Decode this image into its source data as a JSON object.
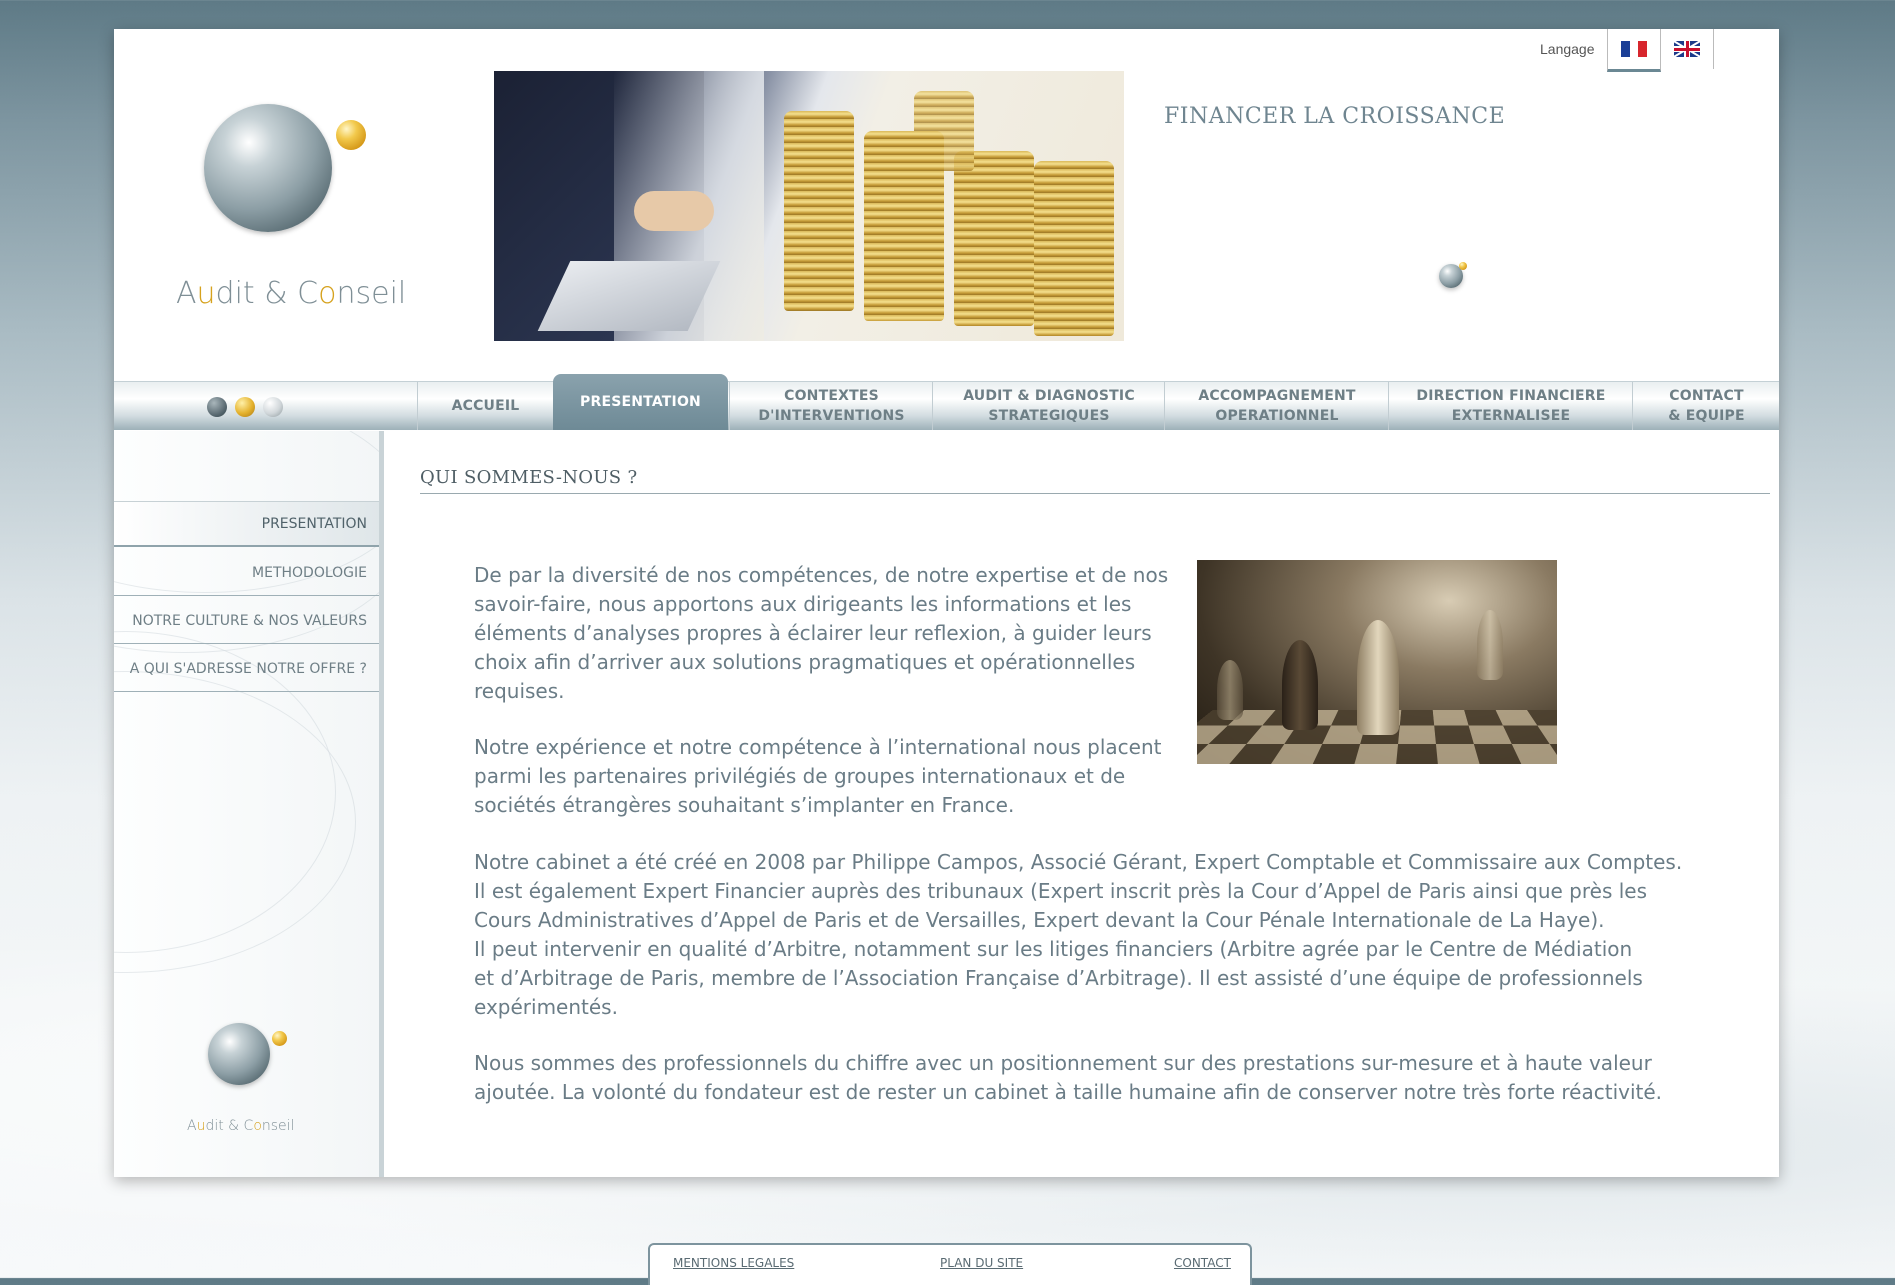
{
  "header": {
    "logo_text": {
      "a": "A",
      "u": "u",
      "dit": "dit & C",
      "o": "o",
      "nseil": "nseil"
    },
    "tagline": "FINANCER LA CROISSANCE",
    "language_label": "Langage",
    "flags": [
      "french-flag-icon",
      "uk-flag-icon"
    ]
  },
  "nav": {
    "items": [
      {
        "line1": "ACCUEIL",
        "line2": ""
      },
      {
        "line1": "PRESENTATION",
        "line2": ""
      },
      {
        "line1": "CONTEXTES",
        "line2": "D'INTERVENTIONS"
      },
      {
        "line1": "AUDIT & DIAGNOSTIC",
        "line2": "STRATEGIQUES"
      },
      {
        "line1": "ACCOMPAGNEMENT",
        "line2": "OPERATIONNEL"
      },
      {
        "line1": "DIRECTION FINANCIERE",
        "line2": "EXTERNALISEE"
      },
      {
        "line1": "CONTACT",
        "line2": "& EQUIPE"
      }
    ],
    "active_index": 1
  },
  "sidebar": {
    "items": [
      {
        "label": "PRESENTATION"
      },
      {
        "label": "METHODOLOGIE"
      },
      {
        "label": "NOTRE CULTURE & NOS VALEURS"
      },
      {
        "label": "A QUI S'ADRESSE NOTRE OFFRE ?"
      }
    ],
    "active_index": 0
  },
  "content": {
    "section_title": "QUI SOMMES-NOUS ?",
    "paragraphs": [
      {
        "lines": [
          "De par la diversité de nos compétences, de notre expertise et de nos",
          "savoir-faire, nous apportons aux dirigeants les informations et les",
          "éléments d’analyses propres à éclairer leur reflexion, à guider leurs",
          "choix afin d’arriver aux solutions pragmatiques et opérationnelles",
          "requises."
        ]
      },
      {
        "lines": [
          "Notre expérience et notre compétence à l’international nous placent",
          "parmi les partenaires privilégiés de groupes internationaux et de",
          "sociétés étrangères souhaitant s’implanter en France."
        ]
      },
      {
        "lines": [
          "Notre cabinet a été créé en 2008 par Philippe Campos, Associé Gérant, Expert Comptable et Commissaire aux Comptes.",
          "Il est également Expert Financier auprès des tribunaux (Expert inscrit près la Cour d’Appel de Paris ainsi que près les",
          "Cours Administratives d’Appel de Paris et de Versailles, Expert devant la Cour Pénale Internationale de La Haye).",
          "Il peut intervenir en qualité d’Arbitre, notamment sur les litiges financiers (Arbitre agrée par le Centre de Médiation",
          "et d’Arbitrage de Paris, membre de l’Association Française d’Arbitrage). Il est assisté d’une équipe de professionnels",
          "expérimentés."
        ]
      },
      {
        "lines": [
          "Nous sommes des professionnels du chiffre avec un positionnement sur des prestations sur-mesure et à haute valeur",
          "ajoutée. La volonté du fondateur est de rester un cabinet à taille humaine afin de conserver notre très forte réactivité."
        ]
      }
    ]
  },
  "footer": {
    "links": [
      "MENTIONS LEGALES",
      "PLAN DU SITE",
      "CONTACT"
    ]
  }
}
